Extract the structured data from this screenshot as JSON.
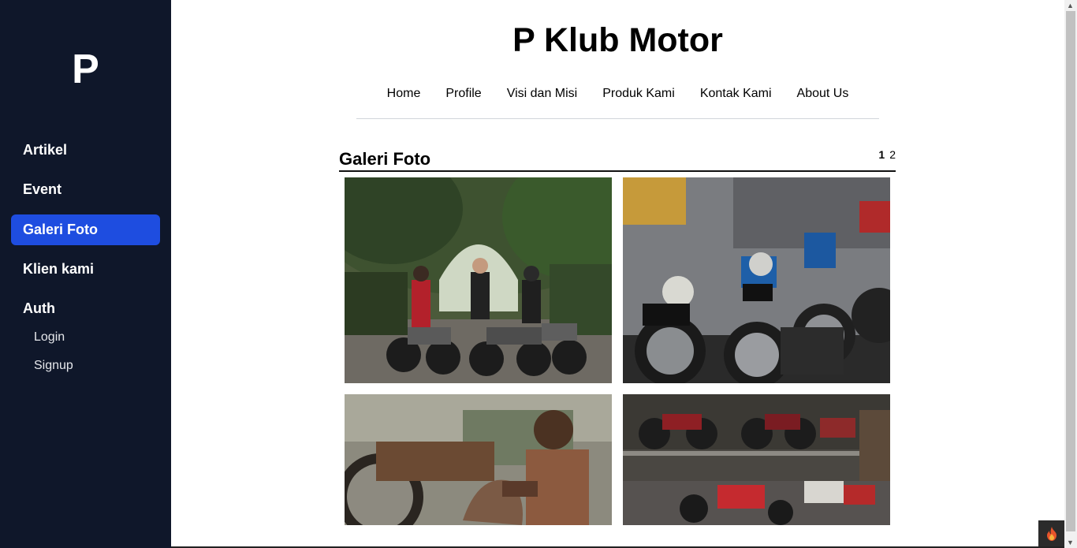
{
  "sidebar": {
    "logo": "P",
    "items": [
      {
        "label": "Artikel"
      },
      {
        "label": "Event"
      },
      {
        "label": "Galeri Foto",
        "active": true
      },
      {
        "label": "Klien kami"
      },
      {
        "label": "Auth"
      }
    ],
    "auth_items": [
      {
        "label": "Login"
      },
      {
        "label": "Signup"
      }
    ],
    "active_color": "#1e4de0",
    "background": "#0f172a"
  },
  "header": {
    "title": "P Klub Motor",
    "nav": [
      {
        "label": "Home"
      },
      {
        "label": "Profile"
      },
      {
        "label": "Visi dan Misi"
      },
      {
        "label": "Produk Kami"
      },
      {
        "label": "Kontak Kami"
      },
      {
        "label": "About Us"
      }
    ]
  },
  "gallery": {
    "title": "Galeri Foto",
    "pages": [
      "1",
      "2"
    ],
    "current_page": "1"
  },
  "icons": {
    "corner_widget": "flame-icon"
  }
}
